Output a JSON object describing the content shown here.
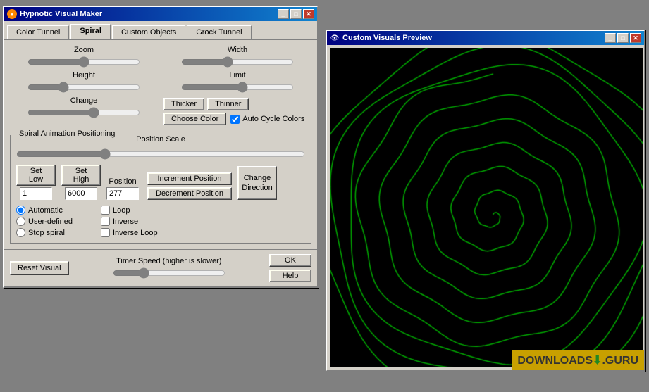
{
  "mainWindow": {
    "title": "Hypnotic Visual Maker",
    "tabs": [
      {
        "id": "color-tunnel",
        "label": "Color Tunnel",
        "active": false
      },
      {
        "id": "spiral",
        "label": "Spiral",
        "active": true
      },
      {
        "id": "custom-objects",
        "label": "Custom Objects",
        "active": false
      },
      {
        "id": "grock-tunnel",
        "label": "Grock Tunnel",
        "active": false
      }
    ],
    "controls": {
      "zoom": {
        "label": "Zoom",
        "value": 50
      },
      "width": {
        "label": "Width",
        "value": 40
      },
      "height": {
        "label": "Height",
        "value": 30
      },
      "limit": {
        "label": "Limit",
        "value": 55
      },
      "change": {
        "label": "Change",
        "value": 60
      }
    },
    "buttons": {
      "thicker": "Thicker",
      "thinner": "Thinner",
      "chooseColor": "Choose Color",
      "autoCycle": "Auto Cycle Colors"
    },
    "animGroup": {
      "label": "Spiral Animation Positioning",
      "positionScaleLabel": "Position Scale",
      "setLow": "Set Low",
      "setHigh": "Set High",
      "position": "Position",
      "setLowValue": "1",
      "setHighValue": "6000",
      "positionValue": "277",
      "incrementPosition": "Increment Position",
      "decrementPosition": "Decrement Position",
      "changeDirection": "Change\nDirection",
      "radioOptions": {
        "automatic": "Automatic",
        "userDefined": "User-defined",
        "stopSpiral": "Stop spiral"
      },
      "checkboxOptions": {
        "loop": "Loop",
        "inverse": "Inverse",
        "inverseLoop": "Inverse Loop"
      }
    }
  },
  "bottomBar": {
    "resetVisual": "Reset Visual",
    "timerLabel": "Timer Speed (higher is slower)",
    "ok": "OK",
    "help": "Help"
  },
  "previewWindow": {
    "title": "Custom Visuals Preview",
    "closeBtn": "✕",
    "maxBtn": "□",
    "minBtn": "─"
  },
  "watermark": {
    "text": "DOWNLOADS",
    "arrow": "⬇",
    "suffix": ".GURU"
  }
}
